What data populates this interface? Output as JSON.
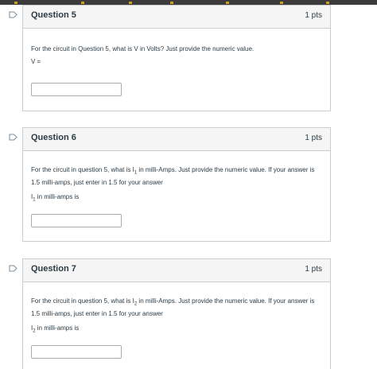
{
  "questions": [
    {
      "title": "Question 5",
      "points": "1 pts",
      "prompt": "For the circuit in Question 5, what is V in Volts?  Just provide the numeric value.",
      "label": "V =",
      "answer_value": ""
    },
    {
      "title": "Question 6",
      "points": "1 pts",
      "prompt_pre": "For the circuit in question 5, what is I",
      "prompt_sub": "1",
      "prompt_post": " in milli-Amps.  Just provide the numeric value.  If your answer is 1.5 milli-amps, just enter in 1.5 for your answer",
      "label_pre": "I",
      "label_sub": "1",
      "label_post": " in milli-amps is",
      "answer_value": ""
    },
    {
      "title": "Question 7",
      "points": "1 pts",
      "prompt_pre": "For the circuit in question 5, what is I",
      "prompt_sub": "2",
      "prompt_post": " in milli-Amps.  Just provide the numeric value.  If your answer is 1.5 milli-amps, just enter in 1.5 for your answer",
      "label_pre": "I",
      "label_sub": "2",
      "label_post": " in milli-amps is",
      "answer_value": ""
    }
  ],
  "icons": {
    "flag": "bookmark-flag-icon"
  },
  "colors": {
    "flag_stroke": "#7a8d99",
    "border": "#c7cdd1",
    "header_bg": "#f5f5f5",
    "text": "#2d3b45"
  }
}
